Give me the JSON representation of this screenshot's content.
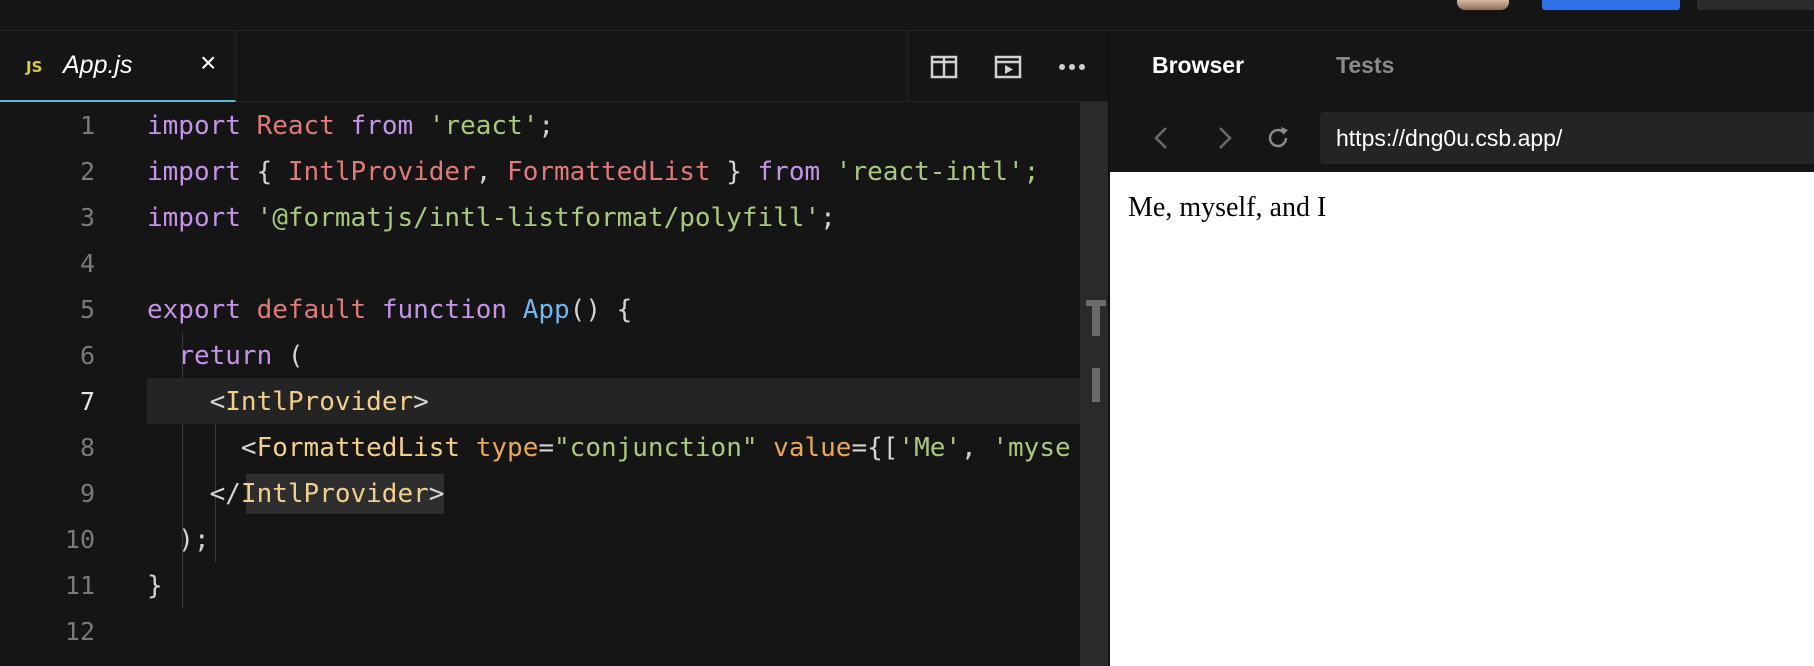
{
  "editor": {
    "tab": {
      "badge": "JS",
      "filename": "App.js",
      "close": "×"
    },
    "lines": [
      {
        "n": "1"
      },
      {
        "n": "2"
      },
      {
        "n": "3"
      },
      {
        "n": "4"
      },
      {
        "n": "5"
      },
      {
        "n": "6"
      },
      {
        "n": "7"
      },
      {
        "n": "8"
      },
      {
        "n": "9"
      },
      {
        "n": "10"
      },
      {
        "n": "11"
      },
      {
        "n": "12"
      }
    ],
    "tokens": {
      "import": "import",
      "from": "from",
      "react_name": "React",
      "react_pkg": "'react'",
      "intl_provider": "IntlProvider",
      "formatted_list": "FormattedList",
      "react_intl_pkg": "'react-intl';",
      "polyfill_pkg": "'@formatjs/intl-listformat/polyfill'",
      "export": "export",
      "default": "default",
      "function": "function",
      "app": "App",
      "return": "return",
      "type_attr": "type",
      "type_value": "\"conjunction\"",
      "value_attr": "value",
      "me": "'Me'",
      "myself_cut": "'myse"
    }
  },
  "browser": {
    "tabs": [
      "Browser",
      "Tests"
    ],
    "url": "https://dng0u.csb.app/",
    "rendered_text": "Me, myself, and I"
  },
  "colors": {
    "accent_tab": "#5db7d8",
    "primary_button": "#2f6fe8"
  }
}
